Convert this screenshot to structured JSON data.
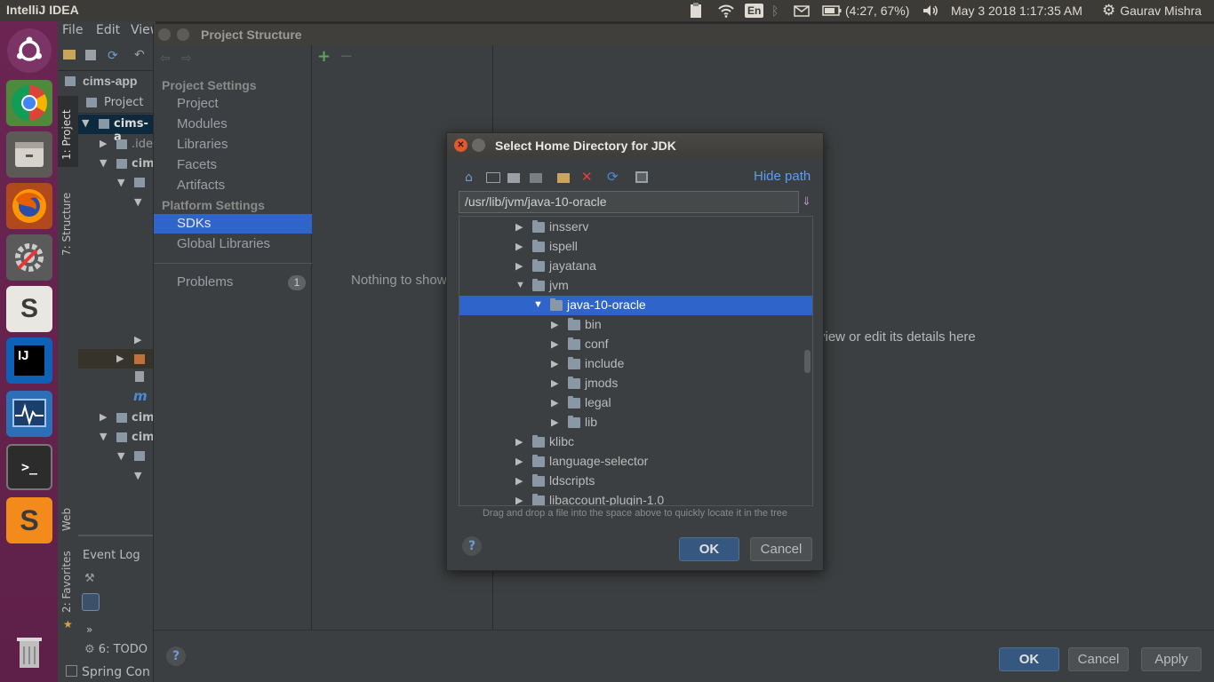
{
  "topbar": {
    "app_title": "IntelliJ IDEA",
    "keyboard": "En",
    "battery": "(4:27, 67%)",
    "datetime": "May 3 2018  1:17:35 AM",
    "user": "Gaurav Mishra"
  },
  "launcher": {
    "items": [
      "ubuntu-dash",
      "chrome",
      "files",
      "firefox",
      "system-settings",
      "slack",
      "intellij",
      "system-monitor",
      "terminal",
      "sublime",
      "trash"
    ]
  },
  "ide": {
    "menu": [
      "File",
      "Edit",
      "View"
    ],
    "project_name": "cims-app",
    "project_tab": "Project",
    "tree_root": "cims-a",
    "tree_items": [
      ".ide",
      "cim",
      "cim",
      "cim"
    ],
    "side_tabs": {
      "project": "1: Project",
      "structure": "7: Structure",
      "web": "Web",
      "favorites": "2: Favorites"
    },
    "event_log": "Event Log",
    "todo": "6: TODO",
    "spring": "Spring Con"
  },
  "project_structure": {
    "title": "Project Structure",
    "project_settings_header": "Project Settings",
    "project_settings": [
      "Project",
      "Modules",
      "Libraries",
      "Facets",
      "Artifacts"
    ],
    "platform_settings_header": "Platform Settings",
    "platform_settings": [
      "SDKs",
      "Global Libraries"
    ],
    "selected": "SDKs",
    "problems_label": "Problems",
    "problems_count": "1",
    "empty_text": "Nothing to show",
    "details_text": "view or edit its details here",
    "ok": "OK",
    "cancel": "Cancel",
    "apply": "Apply"
  },
  "jdk_dialog": {
    "title": "Select Home Directory for JDK",
    "hide_path": "Hide path",
    "path": "/usr/lib/jvm/java-10-oracle",
    "hint": "Drag and drop a file into the space above to quickly locate it in the tree",
    "ok": "OK",
    "cancel": "Cancel",
    "tree": [
      {
        "name": "insserv",
        "level": 0,
        "expanded": false
      },
      {
        "name": "ispell",
        "level": 0,
        "expanded": false
      },
      {
        "name": "jayatana",
        "level": 0,
        "expanded": false
      },
      {
        "name": "jvm",
        "level": 0,
        "expanded": true
      },
      {
        "name": "java-10-oracle",
        "level": 1,
        "expanded": true,
        "selected": true
      },
      {
        "name": "bin",
        "level": 2,
        "expanded": false
      },
      {
        "name": "conf",
        "level": 2,
        "expanded": false
      },
      {
        "name": "include",
        "level": 2,
        "expanded": false
      },
      {
        "name": "jmods",
        "level": 2,
        "expanded": false
      },
      {
        "name": "legal",
        "level": 2,
        "expanded": false
      },
      {
        "name": "lib",
        "level": 2,
        "expanded": false
      },
      {
        "name": "klibc",
        "level": 0,
        "expanded": false
      },
      {
        "name": "language-selector",
        "level": 0,
        "expanded": false
      },
      {
        "name": "ldscripts",
        "level": 0,
        "expanded": false
      },
      {
        "name": "libaccount-plugin-1.0",
        "level": 0,
        "expanded": false
      }
    ]
  },
  "colors": {
    "selection": "#2f65ca",
    "link": "#589df6",
    "panel": "#3c3f41"
  }
}
